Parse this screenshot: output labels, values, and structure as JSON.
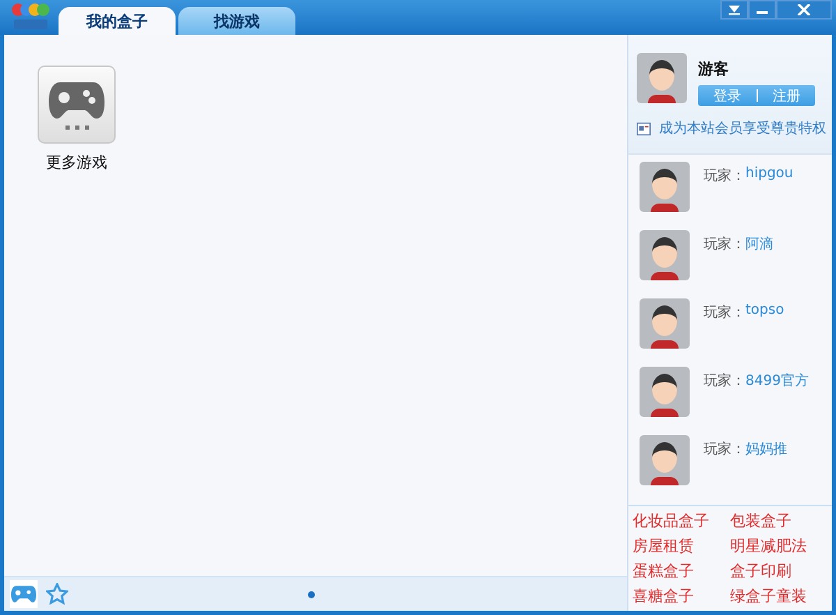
{
  "tabs": [
    {
      "label": "我的盒子",
      "selected": true
    },
    {
      "label": "找游戏",
      "selected": false
    }
  ],
  "games": [
    {
      "label": "更多游戏"
    }
  ],
  "user": {
    "name": "游客",
    "login": "登录",
    "register": "注册",
    "member_link": "成为本站会员享受尊贵特权"
  },
  "players": [
    {
      "prefix": "玩家：",
      "name": "hipgou"
    },
    {
      "prefix": "玩家：",
      "name": "阿滴"
    },
    {
      "prefix": "玩家：",
      "name": "topso"
    },
    {
      "prefix": "玩家：",
      "name": "8499官方"
    },
    {
      "prefix": "玩家：",
      "name": "妈妈推"
    }
  ],
  "ad_links": [
    "化妆品盒子",
    "包装盒子",
    "房屋租赁",
    "明星减肥法",
    "蛋糕盒子",
    "盒子印刷",
    "喜糖盒子",
    "绿盒子童装"
  ],
  "bottom_tabs": [
    {
      "kind": "games",
      "selected": true
    },
    {
      "kind": "favorites",
      "selected": false
    }
  ]
}
